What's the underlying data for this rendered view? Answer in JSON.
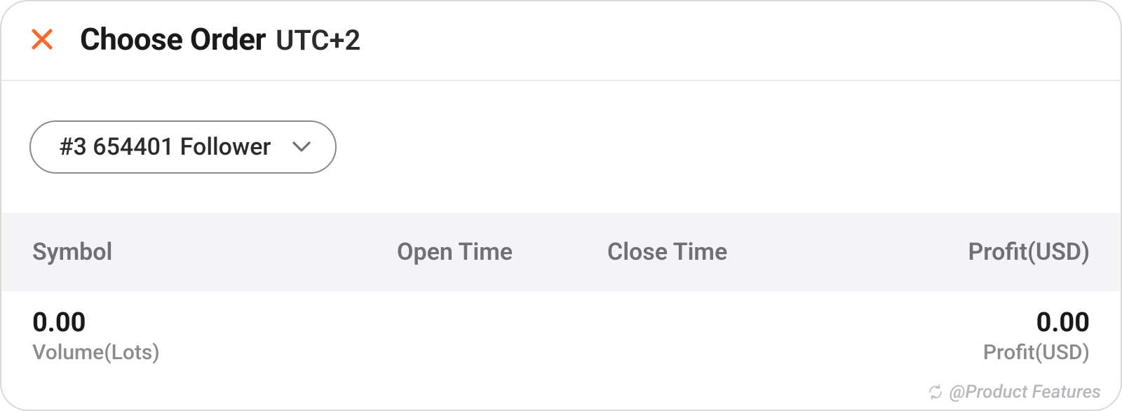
{
  "header": {
    "title": "Choose Order",
    "timezone": "UTC+2"
  },
  "filter": {
    "selected": "#3 654401 Follower"
  },
  "table": {
    "columns": {
      "symbol": "Symbol",
      "open_time": "Open Time",
      "close_time": "Close Time",
      "profit": "Profit(USD)"
    }
  },
  "summary": {
    "volume_value": "0.00",
    "volume_label": "Volume(Lots)",
    "profit_value": "0.00",
    "profit_label": "Profit(USD)"
  },
  "watermark": {
    "text": "@Product Features"
  },
  "colors": {
    "accent": "#ff6a2b",
    "muted": "#6f7074"
  }
}
